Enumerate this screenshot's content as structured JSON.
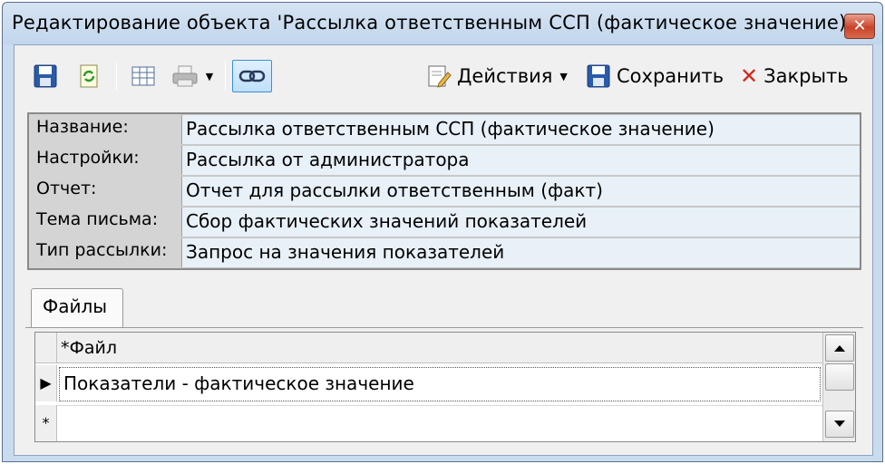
{
  "window": {
    "title": "Редактирование объекта 'Рассылка ответственным ССП (фактическое значение)...",
    "close_label": "✕"
  },
  "toolbar": {
    "save_icon": "floppy-disk-icon",
    "refresh_icon": "refresh-icon",
    "table_icon": "table-icon",
    "print_icon": "printer-icon",
    "link_icon": "link-icon",
    "actions_label": "Действия",
    "save_label": "Сохранить",
    "close_label": "Закрыть"
  },
  "properties": [
    {
      "name": "Название:",
      "value": "Рассылка ответственным ССП (фактическое значение)"
    },
    {
      "name": "Настройки:",
      "value": "Рассылка от администратора"
    },
    {
      "name": "Отчет:",
      "value": "Отчет для рассылки ответственным (факт)"
    },
    {
      "name": "Тема письма:",
      "value": "Сбор фактических значений показателей"
    },
    {
      "name": "Тип рассылки:",
      "value": "Запрос на значения показателей"
    }
  ],
  "tabs": [
    {
      "label": "Файлы"
    }
  ],
  "files_grid": {
    "column_header": "*Файл",
    "rows": [
      {
        "file": "Показатели - фактическое значение"
      }
    ],
    "current_row_marker": "▶",
    "new_row_marker": "*"
  },
  "colors": {
    "window_frame": "#c9dbee",
    "property_value_bg": "#e8f1f8",
    "active_button": "#bfe0fa"
  }
}
